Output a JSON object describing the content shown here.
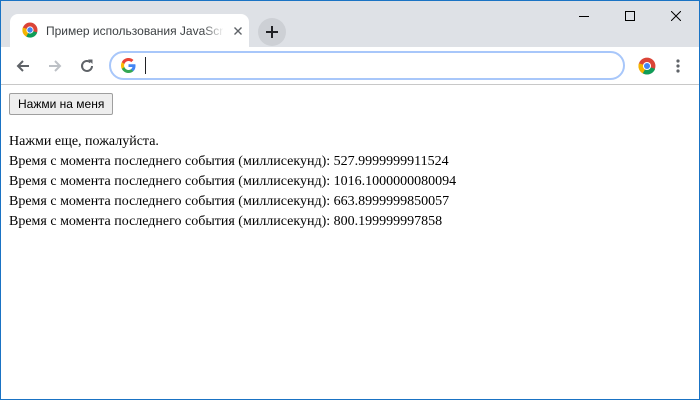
{
  "browser": {
    "tab_title": "Пример использования JavaScript",
    "address_value": "",
    "accent": "#1a73c4",
    "omnibox_border": "#a8c7fa"
  },
  "page": {
    "button_label": "Нажми на меня",
    "lines": [
      "Нажми еще, пожалуйста.",
      "Время с момента последнего события (миллисекунд): 527.9999999911524",
      "Время с момента последнего события (миллисекунд): 1016.1000000080094",
      "Время с момента последнего события (миллисекунд): 663.8999999850057",
      "Время с момента последнего события (миллисекунд): 800.199999997858"
    ]
  }
}
